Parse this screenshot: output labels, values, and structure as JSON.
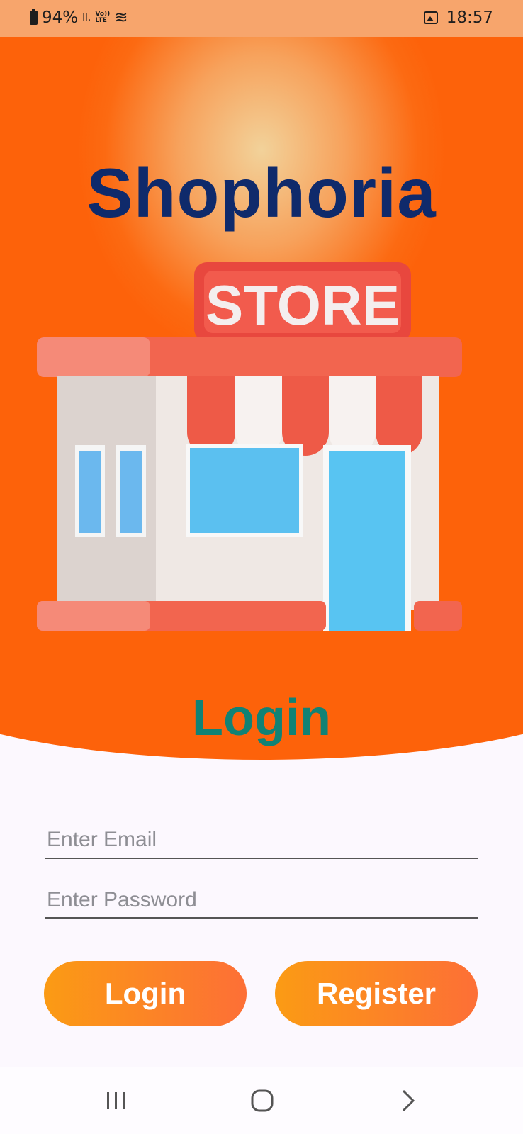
{
  "status_bar": {
    "battery": "94%",
    "signal_glyph": "ll.",
    "volte_top": "Vo))",
    "volte_bottom": "LTE",
    "wifi_glyph": "≋",
    "time": "18:57"
  },
  "app": {
    "title": "Shophoria",
    "store_sign": "STORE",
    "section_heading": "Login"
  },
  "form": {
    "email_placeholder": "Enter Email",
    "email_value": "",
    "password_placeholder": "Enter Password",
    "password_value": ""
  },
  "buttons": {
    "login_label": "Login",
    "register_label": "Register"
  },
  "colors": {
    "hero_orange": "#fd620a",
    "title_navy": "#0f2a6b",
    "heading_teal": "#118275",
    "button_gradient_start": "#fb9b14",
    "button_gradient_end": "#fd6f36"
  },
  "icons": {
    "nav": [
      "recents-icon",
      "home-icon",
      "back-icon"
    ],
    "status": [
      "battery-icon",
      "signal-icon",
      "volte-icon",
      "wifi-icon",
      "image-icon"
    ]
  }
}
